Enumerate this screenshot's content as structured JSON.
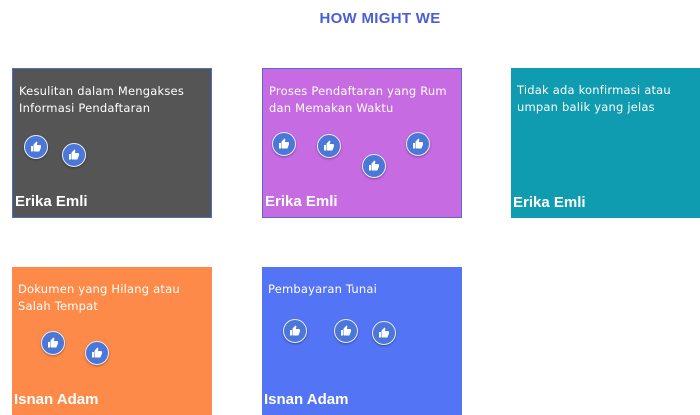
{
  "title": "HOW MIGHT WE",
  "colors": {
    "title": "#4a5fd4",
    "thumb_bubble": "#4a77d8"
  },
  "icons": {
    "like": "thumbs-up-icon"
  },
  "cards": [
    {
      "text": "Kesulitan dalam Mengakses\nInformasi Pendaftaran",
      "author": "Erika Emli",
      "color": "#555555",
      "likes": 2
    },
    {
      "text": "Proses Pendaftaran yang Rum\ndan Memakan Waktu",
      "author": "Erika Emli",
      "color": "#c76be3",
      "likes": 4
    },
    {
      "text": "Tidak ada konfirmasi atau\numpan balik yang jelas",
      "author": "Erika Emli",
      "color": "#0f9bb0",
      "likes": 0
    },
    {
      "text": "Dokumen yang Hilang atau\nSalah Tempat",
      "author": "Isnan Adam",
      "color": "#fd8a48",
      "likes": 2
    },
    {
      "text": "Pembayaran Tunai",
      "author": "Isnan Adam",
      "color": "#5474f6",
      "likes": 3
    }
  ]
}
